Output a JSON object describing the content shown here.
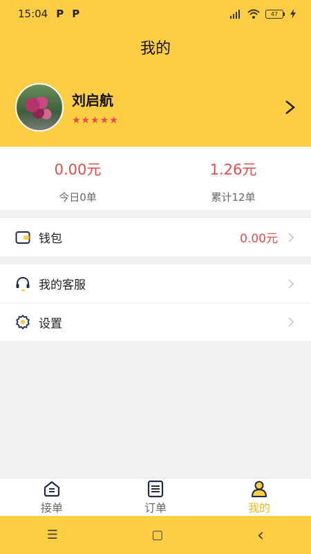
{
  "status": {
    "time": "15:04",
    "app_icons": [
      "P",
      "P"
    ],
    "battery": "47"
  },
  "header": {
    "title": "我的"
  },
  "profile": {
    "name": "刘启航",
    "stars": "★★★★★",
    "chevron": "›"
  },
  "stats": [
    {
      "value": "0.00元",
      "label": "今日0单"
    },
    {
      "value": "1.26元",
      "label": "累计12单"
    }
  ],
  "menu": {
    "wallet": {
      "label": "钱包",
      "value": "0.00元"
    },
    "service": {
      "label": "我的客服"
    },
    "settings": {
      "label": "设置"
    }
  },
  "tabs": [
    {
      "label": "接单",
      "icon": "home-icon"
    },
    {
      "label": "订单",
      "icon": "order-list-icon"
    },
    {
      "label": "我的",
      "icon": "person-icon",
      "active": true
    }
  ],
  "nav": {
    "menu": "☰",
    "home": "▢",
    "back": "‹"
  },
  "colors": {
    "accent": "#fdcd44",
    "price": "#e64a4a",
    "active_tab": "#f3b715"
  }
}
